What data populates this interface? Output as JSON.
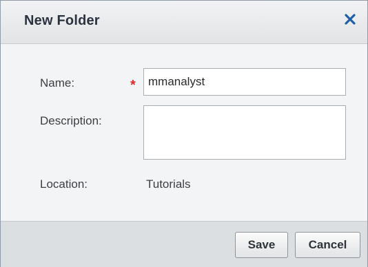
{
  "dialog": {
    "title": "New Folder",
    "close_icon": "close-icon",
    "accent_color": "#1f5fa8"
  },
  "form": {
    "name_label": "Name:",
    "required_marker": "*",
    "name_value": "mmanalyst",
    "description_label": "Description:",
    "description_value": "",
    "location_label": "Location:",
    "location_value": "Tutorials"
  },
  "footer": {
    "save_label": "Save",
    "cancel_label": "Cancel"
  }
}
